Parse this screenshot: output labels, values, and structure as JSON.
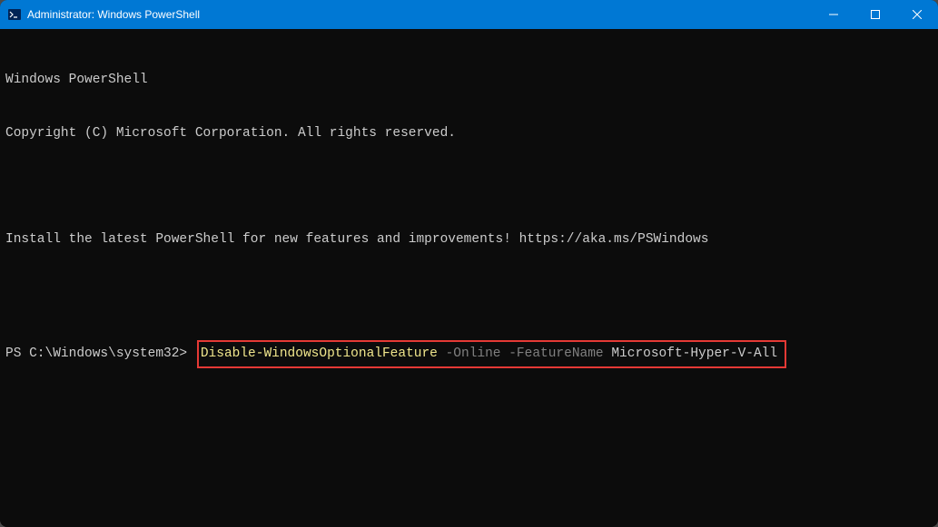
{
  "window": {
    "title": "Administrator: Windows PowerShell"
  },
  "terminal": {
    "line1": "Windows PowerShell",
    "line2": "Copyright (C) Microsoft Corporation. All rights reserved.",
    "line3": "Install the latest PowerShell for new features and improvements! https://aka.ms/PSWindows",
    "prompt": "PS C:\\Windows\\system32> ",
    "cmd": "Disable-WindowsOptionalFeature",
    "param1": " -Online",
    "param2": " -FeatureName",
    "arg": " Microsoft-Hyper-V-All"
  }
}
